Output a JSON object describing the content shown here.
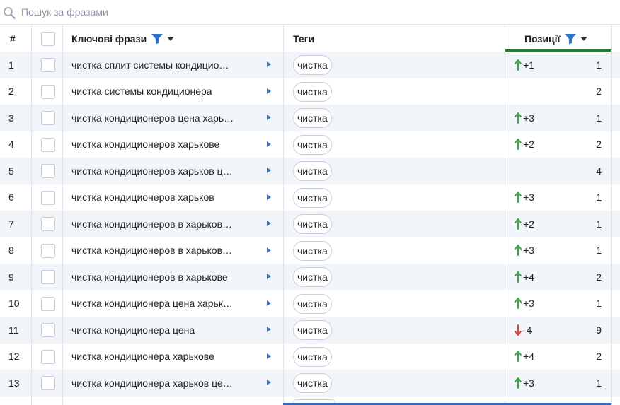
{
  "search": {
    "placeholder": "Пошук за фразами"
  },
  "header": {
    "index": "#",
    "phrases": "Ключові фрази",
    "tags": "Теги",
    "positions": "Позиції"
  },
  "colors": {
    "up": "#3aa64a",
    "down": "#e0453c",
    "accent": "#2d74c9",
    "sort": "#2b7a2b"
  },
  "rows": [
    {
      "n": "1",
      "phrase": "чистка сплит системы кондицио…",
      "tag": "чистка",
      "dir": "up",
      "change": "+1",
      "pos": "1"
    },
    {
      "n": "2",
      "phrase": "чистка системы кондиционера",
      "tag": "чистка",
      "dir": "",
      "change": "",
      "pos": "2"
    },
    {
      "n": "3",
      "phrase": "чистка кондиционеров цена харь…",
      "tag": "чистка",
      "dir": "up",
      "change": "+3",
      "pos": "1"
    },
    {
      "n": "4",
      "phrase": "чистка кондиционеров харькове",
      "tag": "чистка",
      "dir": "up",
      "change": "+2",
      "pos": "2"
    },
    {
      "n": "5",
      "phrase": "чистка кондиционеров харьков ц…",
      "tag": "чистка",
      "dir": "",
      "change": "",
      "pos": "4"
    },
    {
      "n": "6",
      "phrase": "чистка кондиционеров харьков",
      "tag": "чистка",
      "dir": "up",
      "change": "+3",
      "pos": "1"
    },
    {
      "n": "7",
      "phrase": "чистка кондиционеров в харьков…",
      "tag": "чистка",
      "dir": "up",
      "change": "+2",
      "pos": "1"
    },
    {
      "n": "8",
      "phrase": "чистка кондиционеров в харьков…",
      "tag": "чистка",
      "dir": "up",
      "change": "+3",
      "pos": "1"
    },
    {
      "n": "9",
      "phrase": "чистка кондиционеров в харькове",
      "tag": "чистка",
      "dir": "up",
      "change": "+4",
      "pos": "2"
    },
    {
      "n": "10",
      "phrase": "чистка кондиционера цена харьк…",
      "tag": "чистка",
      "dir": "up",
      "change": "+3",
      "pos": "1"
    },
    {
      "n": "11",
      "phrase": "чистка кондиционера цена",
      "tag": "чистка",
      "dir": "down",
      "change": "-4",
      "pos": "9"
    },
    {
      "n": "12",
      "phrase": "чистка кондиционера харькове",
      "tag": "чистка",
      "dir": "up",
      "change": "+4",
      "pos": "2"
    },
    {
      "n": "13",
      "phrase": "чистка кондиционера харьков це…",
      "tag": "чистка",
      "dir": "up",
      "change": "+3",
      "pos": "1"
    }
  ]
}
